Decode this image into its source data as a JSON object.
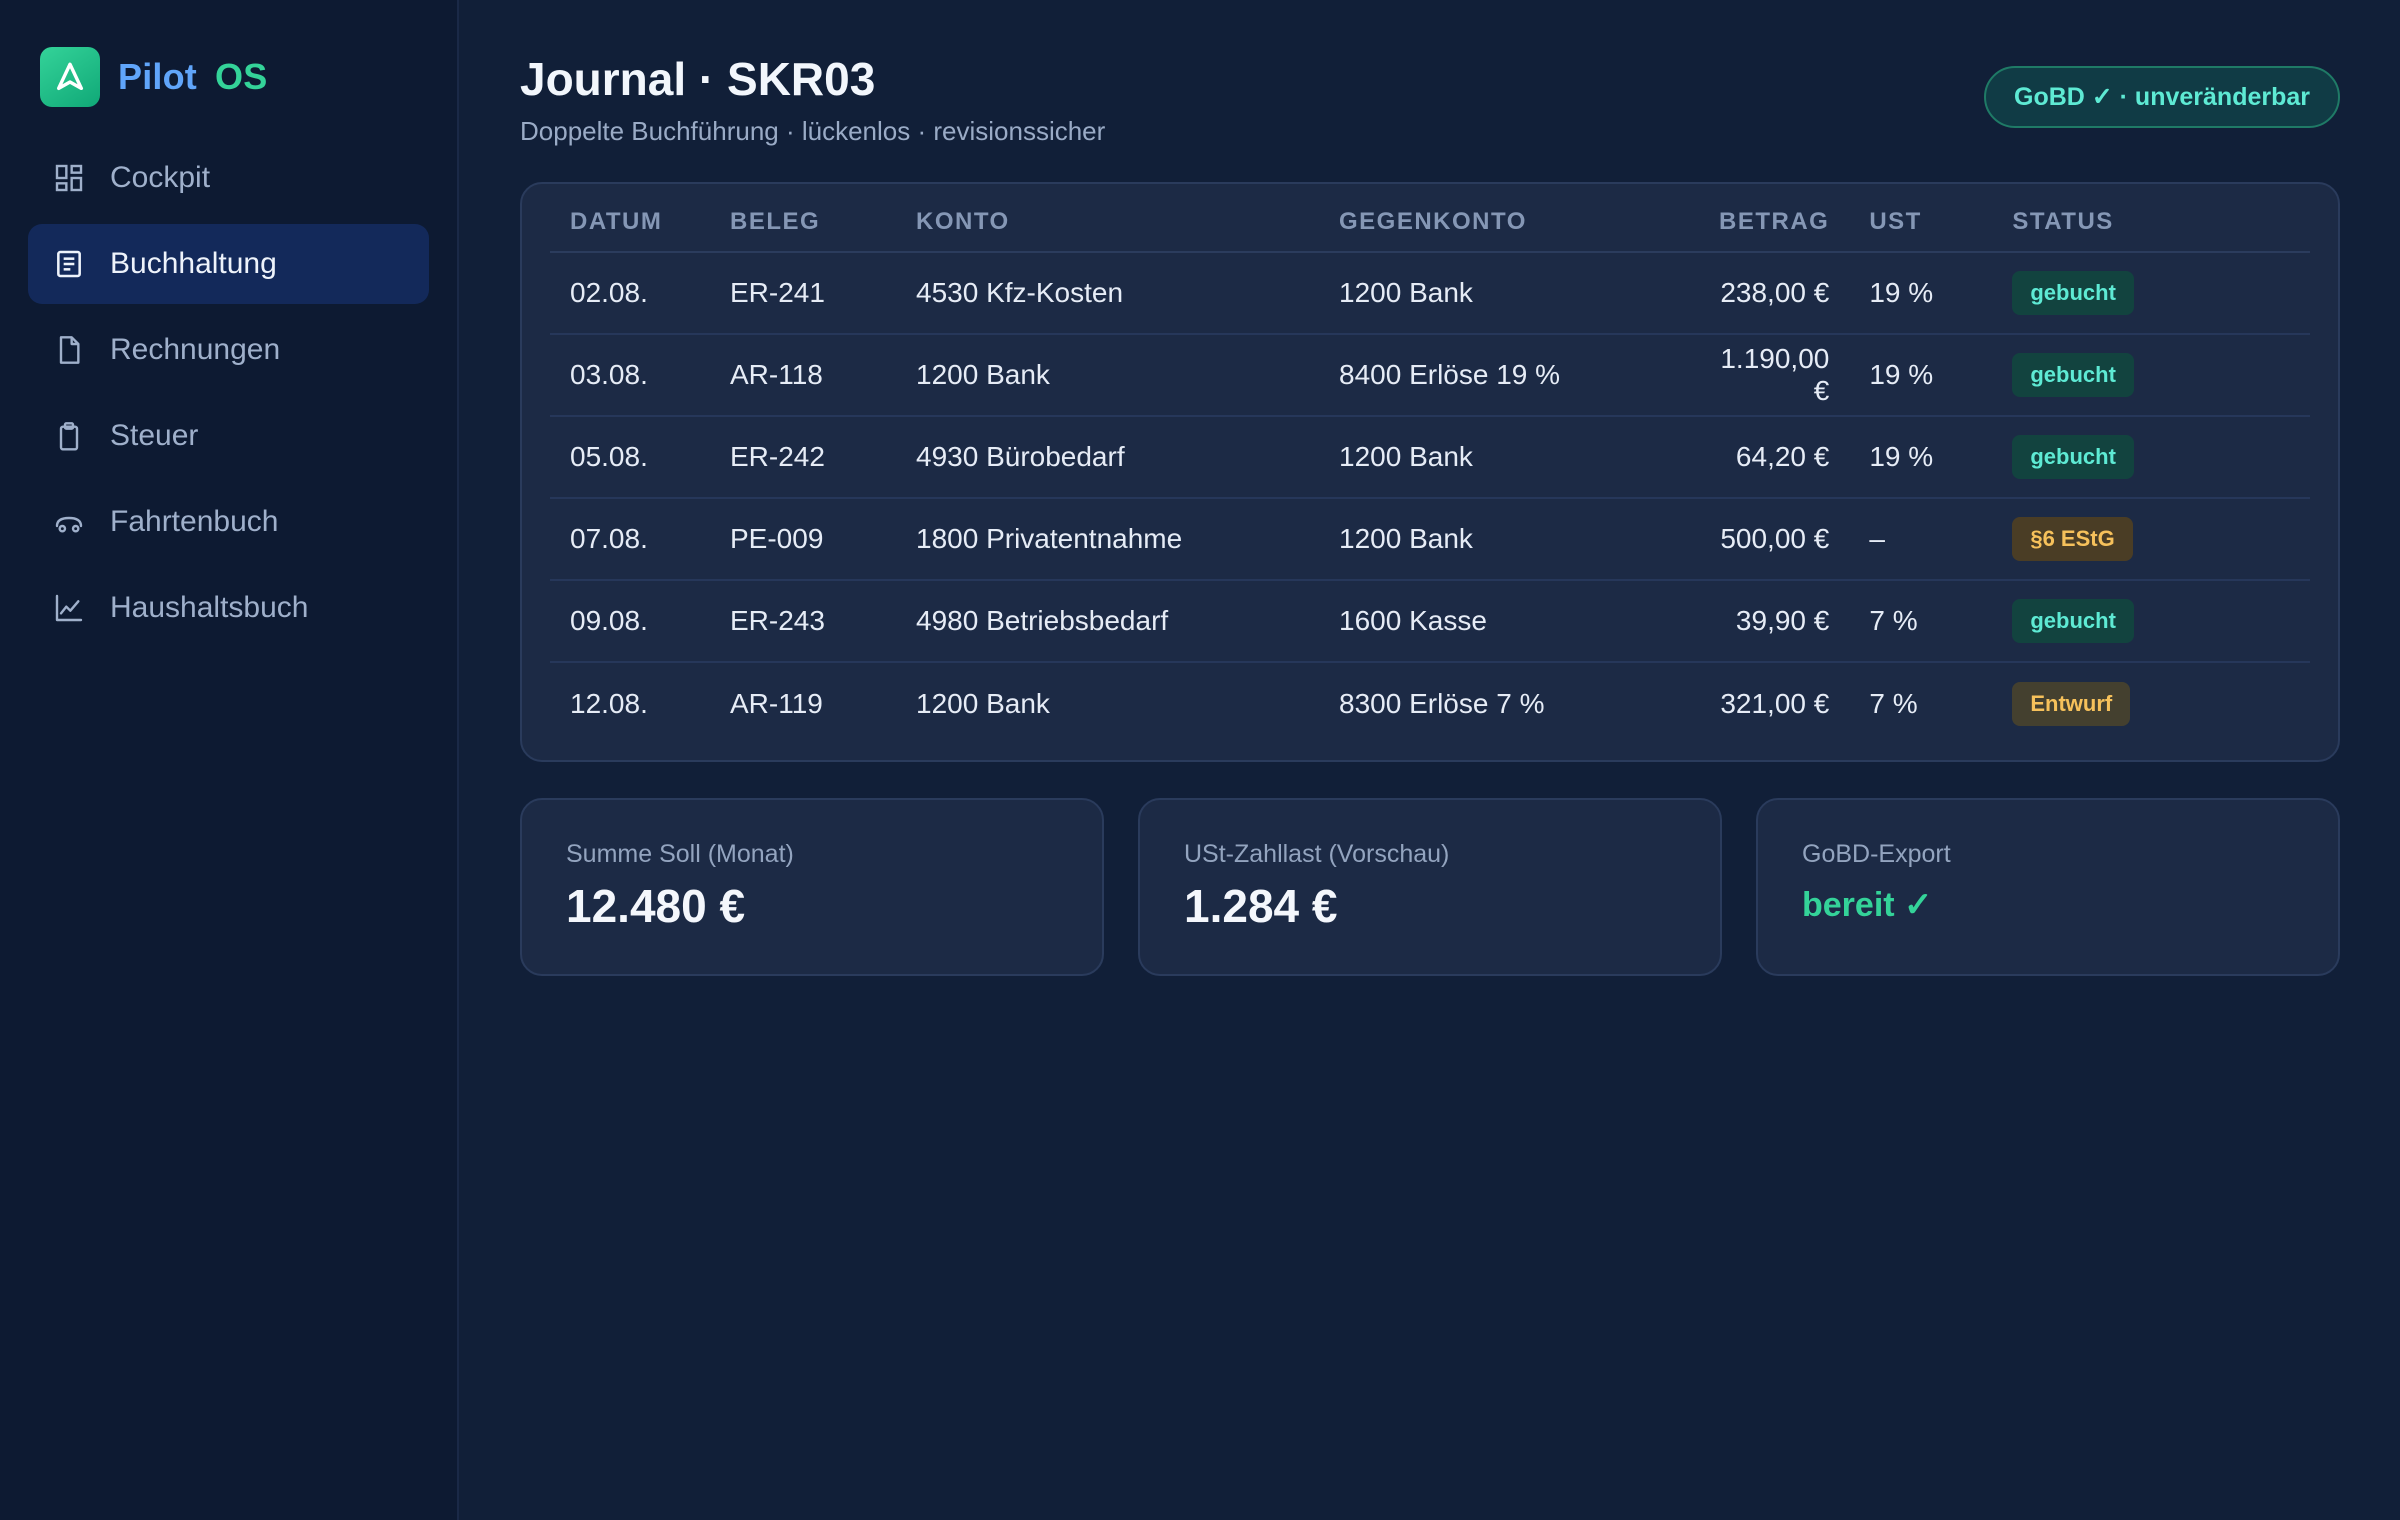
{
  "brand": {
    "name_a": "Pilot",
    "name_b": "OS",
    "logo_icon": "navigation-arrow-icon"
  },
  "sidebar": {
    "items": [
      {
        "label": "Cockpit",
        "icon": "dashboard-grid-icon"
      },
      {
        "label": "Buchhaltung",
        "icon": "ledger-icon",
        "active": true
      },
      {
        "label": "Rechnungen",
        "icon": "document-icon"
      },
      {
        "label": "Steuer",
        "icon": "clipboard-icon"
      },
      {
        "label": "Fahrtenbuch",
        "icon": "car-icon"
      },
      {
        "label": "Haushaltsbuch",
        "icon": "line-chart-icon"
      }
    ]
  },
  "header": {
    "title": "Journal · SKR03",
    "subtitle": "Doppelte Buchführung · lückenlos · revisionssicher",
    "badge": "GoBD ✓ · unveränderbar"
  },
  "journal": {
    "columns": [
      "DATUM",
      "BELEG",
      "KONTO",
      "GEGENKONTO",
      "BETRAG",
      "UST",
      "STATUS"
    ],
    "rows": [
      {
        "datum": "02.08.",
        "beleg": "ER-241",
        "konto": "4530 Kfz-Kosten",
        "gegenkonto": "1200 Bank",
        "betrag": "238,00 €",
        "ust": "19 %",
        "status": "gebucht"
      },
      {
        "datum": "03.08.",
        "beleg": "AR-118",
        "konto": "1200 Bank",
        "gegenkonto": "8400 Erlöse 19 %",
        "betrag": "1.190,00 €",
        "ust": "19 %",
        "status": "gebucht"
      },
      {
        "datum": "05.08.",
        "beleg": "ER-242",
        "konto": "4930 Bürobedarf",
        "gegenkonto": "1200 Bank",
        "betrag": "64,20 €",
        "ust": "19 %",
        "status": "gebucht"
      },
      {
        "datum": "07.08.",
        "beleg": "PE-009",
        "konto": "1800 Privatentnahme",
        "gegenkonto": "1200 Bank",
        "betrag": "500,00 €",
        "ust": "–",
        "status": "§6 EStG"
      },
      {
        "datum": "09.08.",
        "beleg": "ER-243",
        "konto": "4980 Betriebsbedarf",
        "gegenkonto": "1600 Kasse",
        "betrag": "39,90 €",
        "ust": "7 %",
        "status": "gebucht"
      },
      {
        "datum": "12.08.",
        "beleg": "AR-119",
        "konto": "1200 Bank",
        "gegenkonto": "8300 Erlöse 7 %",
        "betrag": "321,00 €",
        "ust": "7 %",
        "status": "Entwurf"
      }
    ]
  },
  "summary": {
    "soll_label": "Summe Soll (Monat)",
    "soll_value": "12.480 €",
    "ust_label": "USt-Zahllast (Vorschau)",
    "ust_value": "1.284 €",
    "export_label": "GoBD-Export",
    "export_value": "bereit ✓"
  },
  "colors": {
    "accent_green": "#34d399",
    "accent_blue": "#60a5fa",
    "status_booked": "#5eead4",
    "status_warn": "#f6c15b"
  }
}
